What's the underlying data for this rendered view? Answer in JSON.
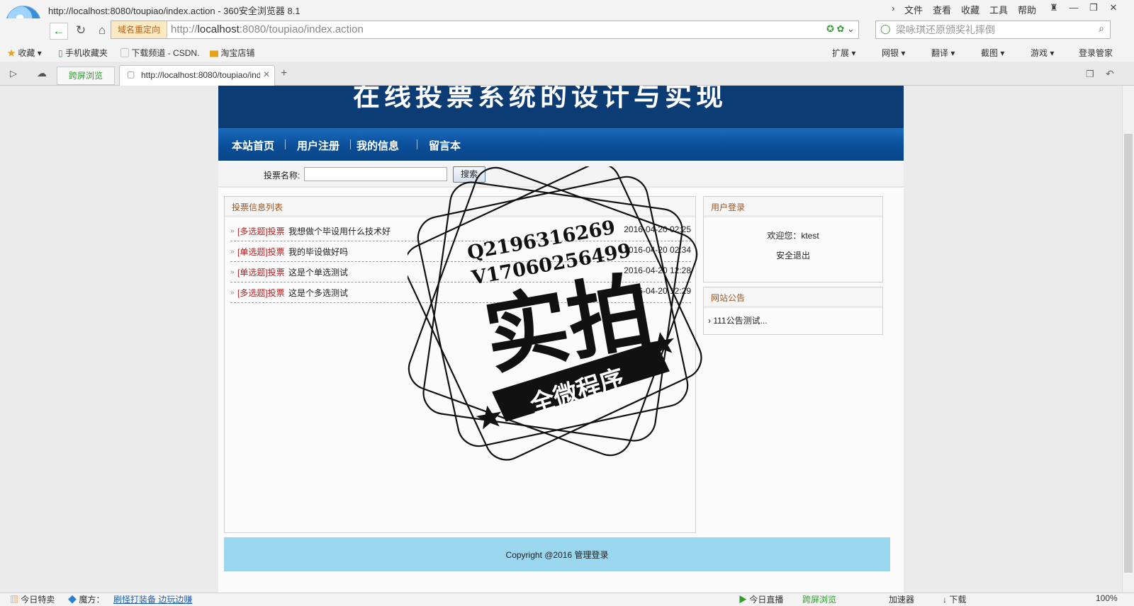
{
  "window": {
    "title": "http://localhost:8080/toupiao/index.action - 360安全浏览器 8.1",
    "menu": [
      "文件",
      "查看",
      "收藏",
      "工具",
      "帮助"
    ]
  },
  "address_bar": {
    "redirect_tag": "域名重定向",
    "url_prefix": "http://",
    "url_host": "localhost",
    "url_rest": ":8080/toupiao/index.action",
    "search_placeholder": "梁咏琪还原颁奖礼摔倒"
  },
  "bookmarks": {
    "items": [
      "收藏",
      "手机收藏夹",
      "下载频道 - CSDN.",
      "淘宝店铺"
    ],
    "right_tools": [
      "扩展",
      "网银",
      "翻译",
      "截图",
      "游戏",
      "登录管家"
    ]
  },
  "tabs": {
    "screen_button": "跨屏浏览",
    "active_tab": "http://localhost:8080/toupiao/index.action"
  },
  "site": {
    "banner_title": "在线投票系统的设计与实现",
    "nav": [
      "本站首页",
      "用户注册",
      "我的信息",
      "留言本"
    ],
    "search_label": "投票名称:",
    "search_button": "搜索",
    "vote_panel_title": "投票信息列表",
    "votes": [
      {
        "type": "[多选题]投票",
        "title": "我想做个毕设用什么技术好",
        "date": "2016-04-20 02:25"
      },
      {
        "type": "[单选题]投票",
        "title": "我的毕设做好吗",
        "date": "2016-04-20 02:34"
      },
      {
        "type": "[单选题]投票",
        "title": "这是个单选测试",
        "date": "2016-04-20 12:28"
      },
      {
        "type": "[多选题]投票",
        "title": "这是个多选测试",
        "date": "2016-04-20 12:29"
      }
    ],
    "login_panel_title": "用户登录",
    "welcome": "欢迎您：ktest",
    "logout": "安全退出",
    "notice_panel_title": "网站公告",
    "notice_item": "111公告测试...",
    "copyright": "Copyright @2016 管理登录"
  },
  "watermark": {
    "qq": "Q2196316269",
    "wechat": "V17060256499",
    "big_text": "实拍",
    "banner_text": "全微程序"
  },
  "status_bar": {
    "left": [
      "今日特卖",
      "魔方：",
      "刷怪打装备 边玩边赚"
    ],
    "right": [
      "今日直播",
      "跨屏浏览",
      "加速器",
      "下载",
      "100%"
    ]
  }
}
